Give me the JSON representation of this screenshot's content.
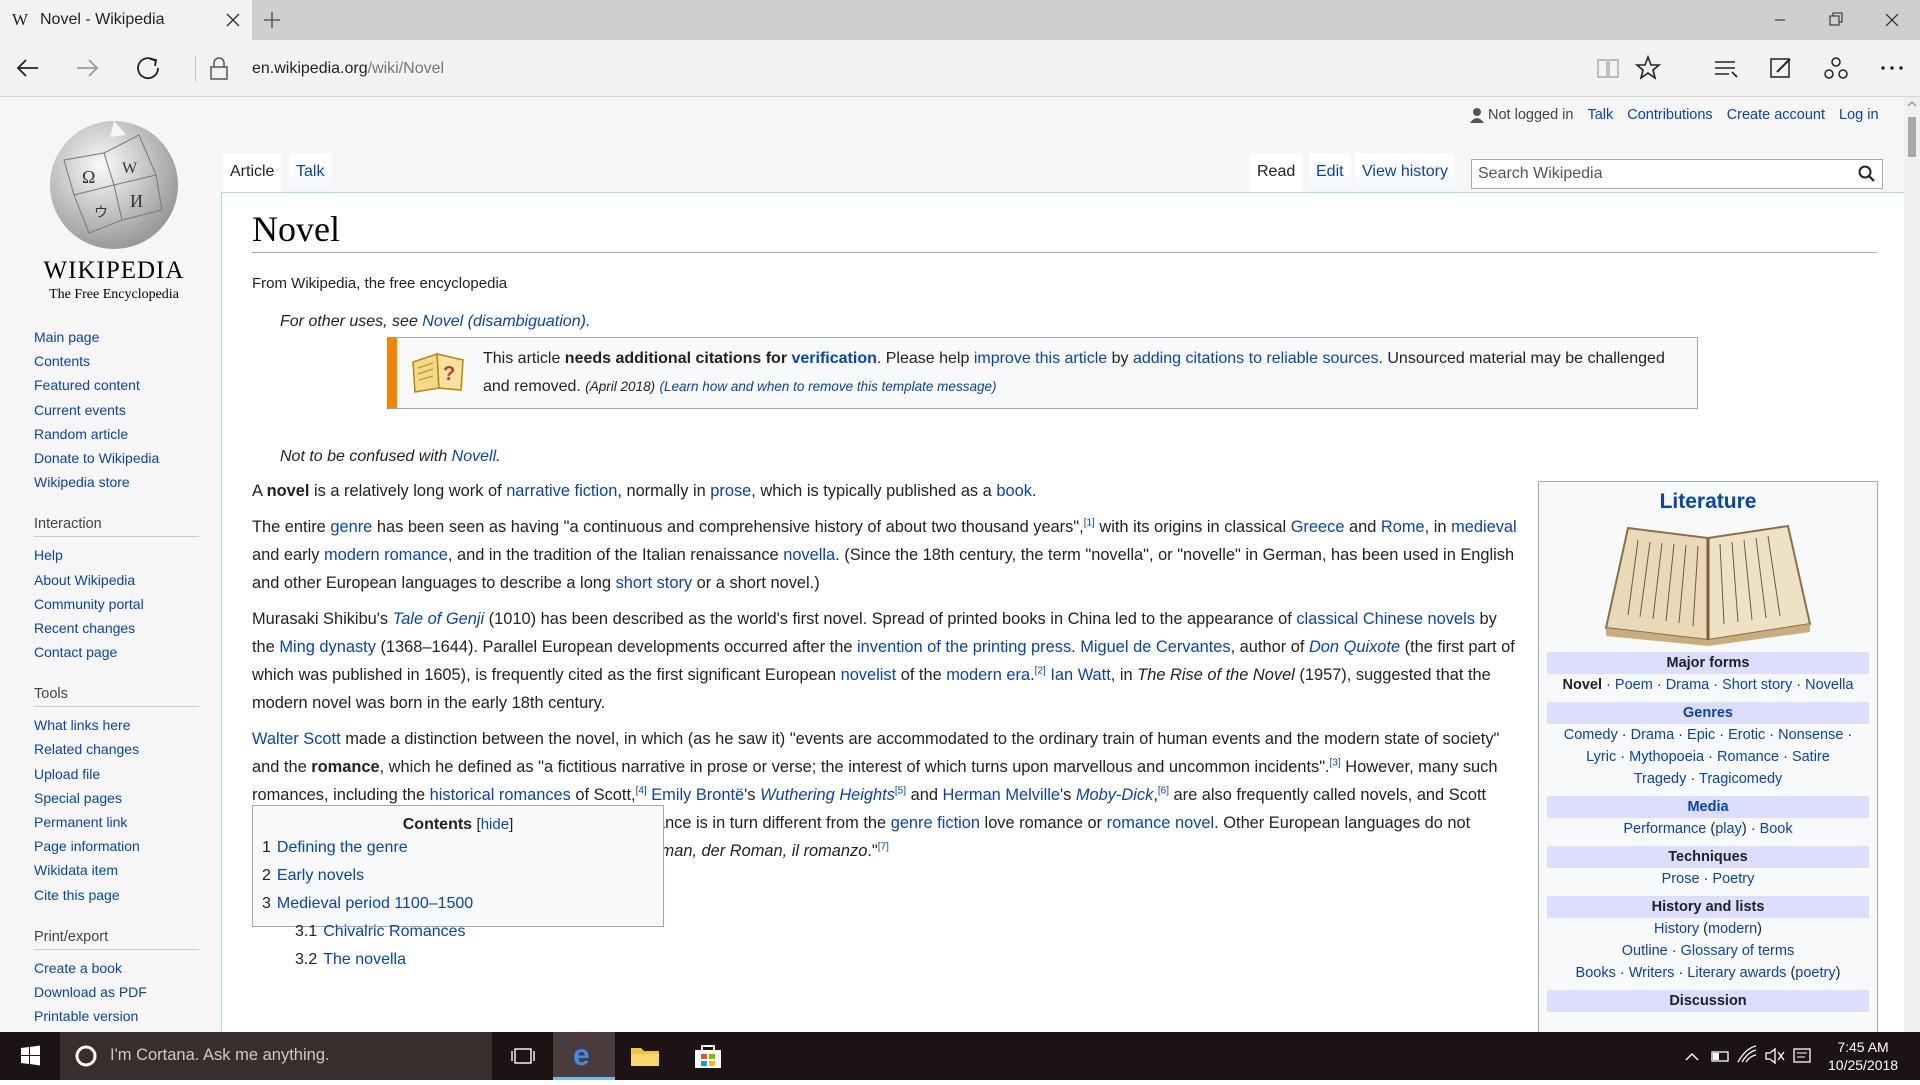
{
  "browser": {
    "tab_icon": "W",
    "tab_title": "Novel - Wikipedia",
    "url_domain": "en.wikipedia.org",
    "url_path": "/wiki/Novel"
  },
  "user_tools": {
    "status": "Not logged in",
    "talk": "Talk",
    "contributions": "Contributions",
    "create_account": "Create account",
    "log_in": "Log in"
  },
  "logo": {
    "wordmark": "Wikipedia",
    "tagline": "The Free Encyclopedia"
  },
  "sidebar": {
    "nav": [
      "Main page",
      "Contents",
      "Featured content",
      "Current events",
      "Random article",
      "Donate to Wikipedia",
      "Wikipedia store"
    ],
    "interaction_head": "Interaction",
    "interaction": [
      "Help",
      "About Wikipedia",
      "Community portal",
      "Recent changes",
      "Contact page"
    ],
    "tools_head": "Tools",
    "tools": [
      "What links here",
      "Related changes",
      "Upload file",
      "Special pages",
      "Permanent link",
      "Page information",
      "Wikidata item",
      "Cite this page"
    ],
    "print_head": "Print/export",
    "print": [
      "Create a book",
      "Download as PDF",
      "Printable version"
    ]
  },
  "tabs": {
    "article": "Article",
    "talk": "Talk",
    "read": "Read",
    "edit": "Edit",
    "history": "View history"
  },
  "search": {
    "placeholder": "Search Wikipedia"
  },
  "article": {
    "title": "Novel",
    "from": "From Wikipedia, the free encyclopedia",
    "hatnote1_pre": "For other uses, see ",
    "hatnote1_link": "Novel (disambiguation)",
    "hatnote1_post": ".",
    "hatnote2_pre": "Not to be confused with ",
    "hatnote2_link": "Novell",
    "hatnote2_post": "."
  },
  "ambox": {
    "t1": "This article ",
    "t2": "needs additional citations for ",
    "t3": "verification",
    "t4": ". Please help ",
    "t5": "improve this article",
    "t6": " by ",
    "t7": "adding citations to reliable sources",
    "t8": ". Unsourced material may be challenged and removed.",
    "date": "(April 2018)",
    "learn": "(Learn how and when to remove this template message)"
  },
  "infobox": {
    "title": "Literature",
    "major_head": "Major forms",
    "major": [
      "Novel",
      "Poem",
      "Drama",
      "Short story",
      "Novella"
    ],
    "genres_head": "Genres",
    "genres_r1": [
      "Comedy",
      "Drama",
      "Epic",
      "Erotic",
      "Nonsense"
    ],
    "genres_r2": [
      "Lyric",
      "Mythopoeia",
      "Romance",
      "Satire"
    ],
    "genres_r3": [
      "Tragedy",
      "Tragicomedy"
    ],
    "media_head": "Media",
    "media_performance": "Performance",
    "media_play": "play",
    "media_book": "Book",
    "tech_head": "Techniques",
    "tech": [
      "Prose",
      "Poetry"
    ],
    "hist_head": "History and lists",
    "hist_history": "History",
    "hist_modern": "modern",
    "hist_outline": "Outline",
    "hist_glossary": "Glossary of terms",
    "hist_books": "Books",
    "hist_writers": "Writers",
    "hist_awards": "Literary awards",
    "hist_poetry": "poetry",
    "discussion_head": "Discussion"
  },
  "toc": {
    "title": "Contents",
    "hide": "hide",
    "items": [
      {
        "num": "1",
        "label": "Defining the genre"
      },
      {
        "num": "2",
        "label": "Early novels"
      },
      {
        "num": "3",
        "label": "Medieval period 1100–1500"
      }
    ],
    "sub": [
      {
        "num": "3.1",
        "label": "Chivalric Romances"
      },
      {
        "num": "3.2",
        "label": "The novella"
      }
    ]
  },
  "taskbar": {
    "cortana": "I'm Cortana. Ask me anything.",
    "time": "7:45 AM",
    "date": "10/25/2018"
  }
}
